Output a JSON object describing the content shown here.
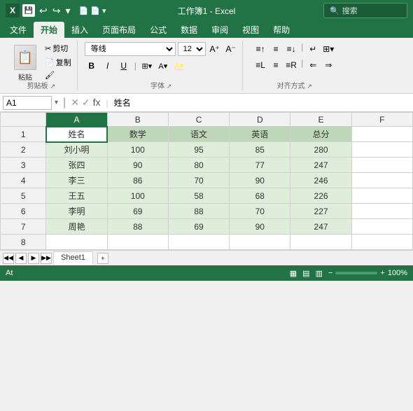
{
  "titlebar": {
    "logo": "X",
    "title": "工作簿1 - Excel",
    "search_placeholder": "搜索"
  },
  "tabs": [
    "文件",
    "开始",
    "插入",
    "页面布局",
    "公式",
    "数据",
    "审阅",
    "视图",
    "帮助"
  ],
  "active_tab": "开始",
  "ribbon": {
    "groups": [
      {
        "label": "剪贴板"
      },
      {
        "label": "字体"
      },
      {
        "label": "对齐方式"
      }
    ],
    "font_name": "等线",
    "font_size": "12",
    "paste_label": "粘贴"
  },
  "formula_bar": {
    "cell_ref": "A1",
    "formula": "姓名"
  },
  "columns": [
    "A",
    "B",
    "C",
    "D",
    "E",
    "F"
  ],
  "rows": [
    {
      "row": "1",
      "cells": [
        "姓名",
        "数学",
        "语文",
        "英语",
        "总分",
        ""
      ]
    },
    {
      "row": "2",
      "cells": [
        "刘小明",
        "100",
        "95",
        "85",
        "280",
        ""
      ]
    },
    {
      "row": "3",
      "cells": [
        "张四",
        "90",
        "80",
        "77",
        "247",
        ""
      ]
    },
    {
      "row": "4",
      "cells": [
        "李三",
        "86",
        "70",
        "90",
        "246",
        ""
      ]
    },
    {
      "row": "5",
      "cells": [
        "王五",
        "100",
        "58",
        "68",
        "226",
        ""
      ]
    },
    {
      "row": "6",
      "cells": [
        "李明",
        "69",
        "88",
        "70",
        "227",
        ""
      ]
    },
    {
      "row": "7",
      "cells": [
        "周艳",
        "88",
        "69",
        "90",
        "247",
        ""
      ]
    },
    {
      "row": "8",
      "cells": [
        "",
        "",
        "",
        "",
        "",
        ""
      ]
    }
  ],
  "sheet": {
    "tabs": [
      "Sheet1"
    ],
    "active": "Sheet1"
  },
  "status": {
    "left": "At",
    "zoom": "100%"
  }
}
